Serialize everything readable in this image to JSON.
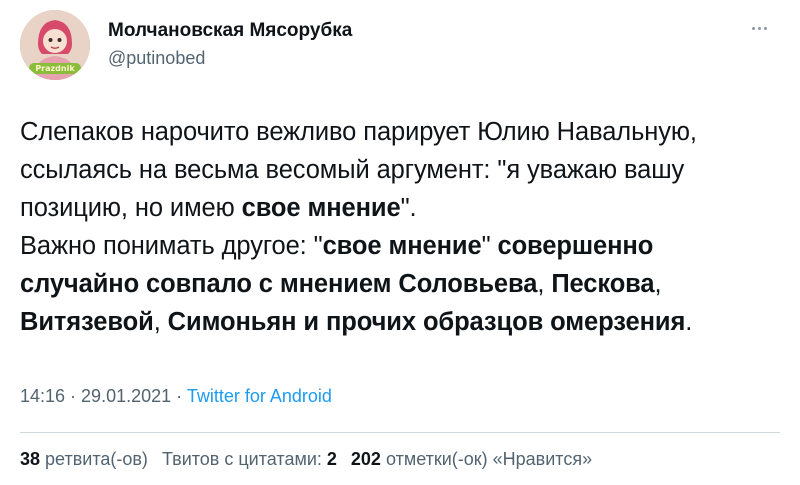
{
  "author": {
    "display_name": "Молчановская Мясорубка",
    "handle": "@putinobed",
    "avatar_badge": "Prazdnik",
    "avatar_icon": "cartoon-girl-avatar"
  },
  "menu_icon": "more-horizontal-icon",
  "tweet": {
    "lines": [
      [
        {
          "t": "Слепаков нарочито вежливо парирует Юлию Навальную,",
          "b": false
        }
      ],
      [
        {
          "t": "ссылаясь на весьма весомый аргумент: \"я уважаю вашу",
          "b": false
        }
      ],
      [
        {
          "t": "позицию, но имею ",
          "b": false
        },
        {
          "t": "свое мнение",
          "b": true
        },
        {
          "t": "\".",
          "b": false
        }
      ],
      [
        {
          "t": "Важно понимать другое: \"",
          "b": false
        },
        {
          "t": "свое мнение",
          "b": true
        },
        {
          "t": "\" ",
          "b": false
        },
        {
          "t": "совершенно",
          "b": true
        }
      ],
      [
        {
          "t": "случайно совпало с мнением Соловьева",
          "b": true
        },
        {
          "t": ", ",
          "b": false
        },
        {
          "t": "Пескова",
          "b": true
        },
        {
          "t": ",",
          "b": false
        }
      ],
      [
        {
          "t": "Витязевой",
          "b": true
        },
        {
          "t": ", ",
          "b": false
        },
        {
          "t": "Симоньян и прочих образцов омерзения",
          "b": true
        },
        {
          "t": ".",
          "b": false
        }
      ]
    ]
  },
  "meta": {
    "time": "14:16",
    "separator": " · ",
    "date": "29.01.2021",
    "separator2": " · ",
    "source": "Twitter for Android"
  },
  "stats": {
    "retweets_count": "38",
    "retweets_label": " ретвита(-ов)",
    "quotes_label": "Твитов с цитатами: ",
    "quotes_count": "2",
    "likes_count": "202",
    "likes_label": " отметки(-ок) «Нравится»"
  },
  "colors": {
    "text": "#0f1419",
    "secondary": "#536471",
    "link": "#1d9bf0",
    "divider": "#cfd9de"
  }
}
